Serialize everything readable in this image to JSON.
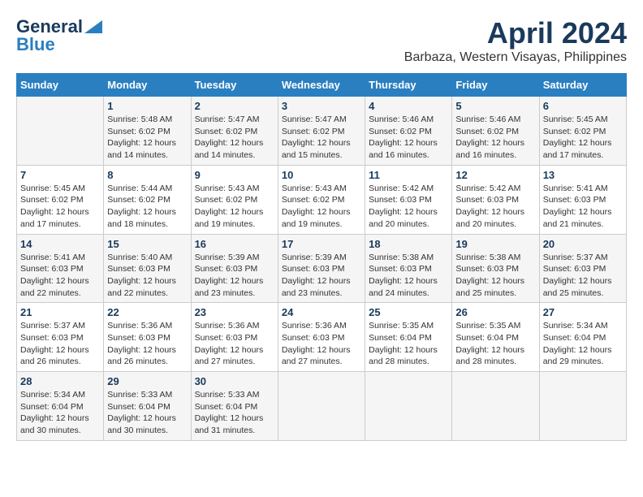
{
  "logo": {
    "line1": "General",
    "line2": "Blue"
  },
  "header": {
    "month": "April 2024",
    "location": "Barbaza, Western Visayas, Philippines"
  },
  "weekdays": [
    "Sunday",
    "Monday",
    "Tuesday",
    "Wednesday",
    "Thursday",
    "Friday",
    "Saturday"
  ],
  "weeks": [
    [
      {
        "day": "",
        "info": ""
      },
      {
        "day": "1",
        "info": "Sunrise: 5:48 AM\nSunset: 6:02 PM\nDaylight: 12 hours\nand 14 minutes."
      },
      {
        "day": "2",
        "info": "Sunrise: 5:47 AM\nSunset: 6:02 PM\nDaylight: 12 hours\nand 14 minutes."
      },
      {
        "day": "3",
        "info": "Sunrise: 5:47 AM\nSunset: 6:02 PM\nDaylight: 12 hours\nand 15 minutes."
      },
      {
        "day": "4",
        "info": "Sunrise: 5:46 AM\nSunset: 6:02 PM\nDaylight: 12 hours\nand 16 minutes."
      },
      {
        "day": "5",
        "info": "Sunrise: 5:46 AM\nSunset: 6:02 PM\nDaylight: 12 hours\nand 16 minutes."
      },
      {
        "day": "6",
        "info": "Sunrise: 5:45 AM\nSunset: 6:02 PM\nDaylight: 12 hours\nand 17 minutes."
      }
    ],
    [
      {
        "day": "7",
        "info": "Sunrise: 5:45 AM\nSunset: 6:02 PM\nDaylight: 12 hours\nand 17 minutes."
      },
      {
        "day": "8",
        "info": "Sunrise: 5:44 AM\nSunset: 6:02 PM\nDaylight: 12 hours\nand 18 minutes."
      },
      {
        "day": "9",
        "info": "Sunrise: 5:43 AM\nSunset: 6:02 PM\nDaylight: 12 hours\nand 19 minutes."
      },
      {
        "day": "10",
        "info": "Sunrise: 5:43 AM\nSunset: 6:02 PM\nDaylight: 12 hours\nand 19 minutes."
      },
      {
        "day": "11",
        "info": "Sunrise: 5:42 AM\nSunset: 6:03 PM\nDaylight: 12 hours\nand 20 minutes."
      },
      {
        "day": "12",
        "info": "Sunrise: 5:42 AM\nSunset: 6:03 PM\nDaylight: 12 hours\nand 20 minutes."
      },
      {
        "day": "13",
        "info": "Sunrise: 5:41 AM\nSunset: 6:03 PM\nDaylight: 12 hours\nand 21 minutes."
      }
    ],
    [
      {
        "day": "14",
        "info": "Sunrise: 5:41 AM\nSunset: 6:03 PM\nDaylight: 12 hours\nand 22 minutes."
      },
      {
        "day": "15",
        "info": "Sunrise: 5:40 AM\nSunset: 6:03 PM\nDaylight: 12 hours\nand 22 minutes."
      },
      {
        "day": "16",
        "info": "Sunrise: 5:39 AM\nSunset: 6:03 PM\nDaylight: 12 hours\nand 23 minutes."
      },
      {
        "day": "17",
        "info": "Sunrise: 5:39 AM\nSunset: 6:03 PM\nDaylight: 12 hours\nand 23 minutes."
      },
      {
        "day": "18",
        "info": "Sunrise: 5:38 AM\nSunset: 6:03 PM\nDaylight: 12 hours\nand 24 minutes."
      },
      {
        "day": "19",
        "info": "Sunrise: 5:38 AM\nSunset: 6:03 PM\nDaylight: 12 hours\nand 25 minutes."
      },
      {
        "day": "20",
        "info": "Sunrise: 5:37 AM\nSunset: 6:03 PM\nDaylight: 12 hours\nand 25 minutes."
      }
    ],
    [
      {
        "day": "21",
        "info": "Sunrise: 5:37 AM\nSunset: 6:03 PM\nDaylight: 12 hours\nand 26 minutes."
      },
      {
        "day": "22",
        "info": "Sunrise: 5:36 AM\nSunset: 6:03 PM\nDaylight: 12 hours\nand 26 minutes."
      },
      {
        "day": "23",
        "info": "Sunrise: 5:36 AM\nSunset: 6:03 PM\nDaylight: 12 hours\nand 27 minutes."
      },
      {
        "day": "24",
        "info": "Sunrise: 5:36 AM\nSunset: 6:03 PM\nDaylight: 12 hours\nand 27 minutes."
      },
      {
        "day": "25",
        "info": "Sunrise: 5:35 AM\nSunset: 6:04 PM\nDaylight: 12 hours\nand 28 minutes."
      },
      {
        "day": "26",
        "info": "Sunrise: 5:35 AM\nSunset: 6:04 PM\nDaylight: 12 hours\nand 28 minutes."
      },
      {
        "day": "27",
        "info": "Sunrise: 5:34 AM\nSunset: 6:04 PM\nDaylight: 12 hours\nand 29 minutes."
      }
    ],
    [
      {
        "day": "28",
        "info": "Sunrise: 5:34 AM\nSunset: 6:04 PM\nDaylight: 12 hours\nand 30 minutes."
      },
      {
        "day": "29",
        "info": "Sunrise: 5:33 AM\nSunset: 6:04 PM\nDaylight: 12 hours\nand 30 minutes."
      },
      {
        "day": "30",
        "info": "Sunrise: 5:33 AM\nSunset: 6:04 PM\nDaylight: 12 hours\nand 31 minutes."
      },
      {
        "day": "",
        "info": ""
      },
      {
        "day": "",
        "info": ""
      },
      {
        "day": "",
        "info": ""
      },
      {
        "day": "",
        "info": ""
      }
    ]
  ]
}
